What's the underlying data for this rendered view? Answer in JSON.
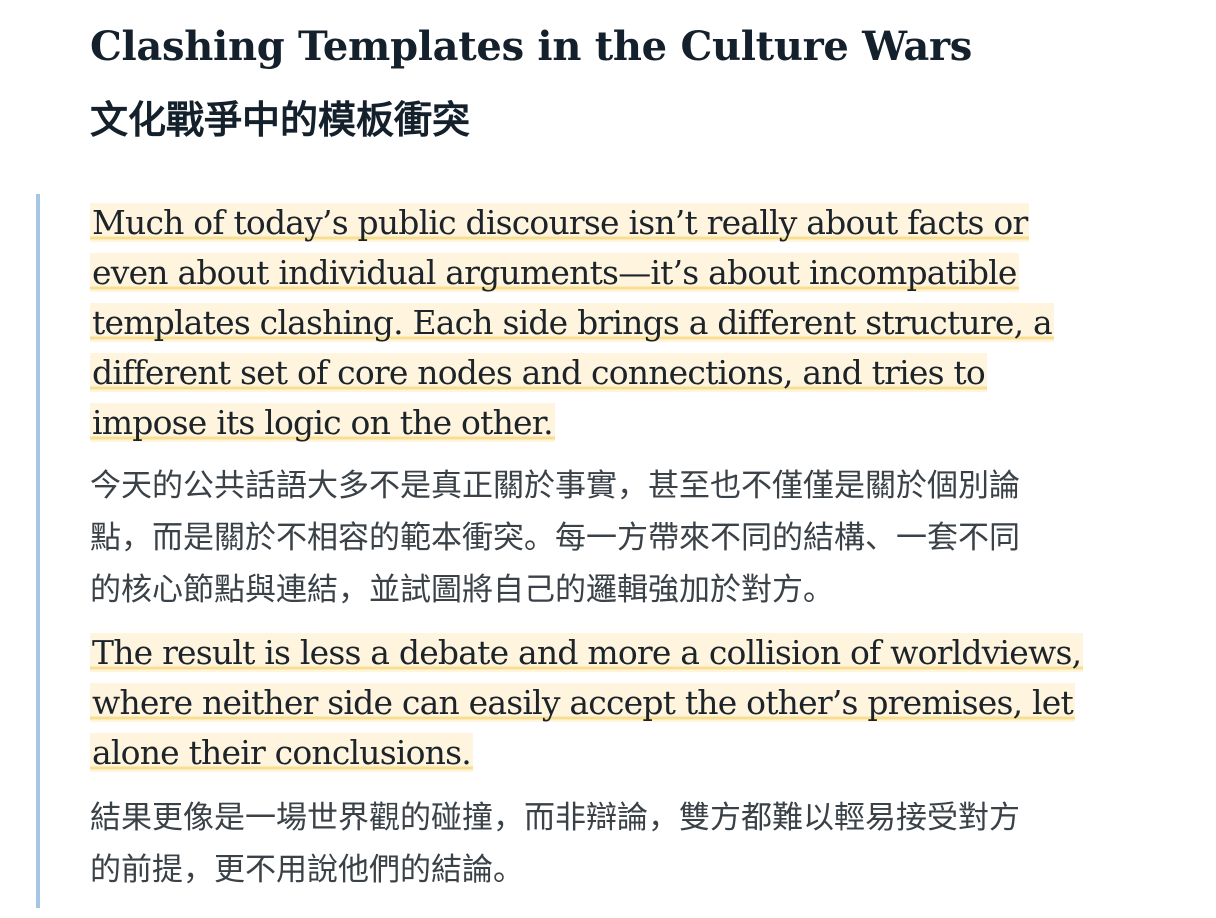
{
  "title_en": "Clashing Templates in the Culture Wars",
  "title_zh": "文化戰爭中的模板衝突",
  "quote": {
    "accent_color": "#a7c6e4",
    "highlight_color": "#fff5df",
    "underline_color": "#f8de90",
    "para1_en": [
      "Much of today’s public discourse isn’t really about facts or",
      "even about individual arguments—it’s about incompatible",
      "templates clashing. Each side brings a different structure, a",
      "different set of core nodes and connections, and tries to",
      "impose its logic on the other."
    ],
    "para1_zh": [
      "今天的公共話語大多不是真正關於事實，甚至也不僅僅是關於個別論",
      "點，而是關於不相容的範本衝突。每一方帶來不同的結構、一套不同",
      "的核心節點與連結，並試圖將自己的邏輯強加於對方。"
    ],
    "para2_en": [
      "The result is less a debate and more a collision of worldviews,",
      "where neither side can easily accept the other’s premises, let",
      "alone their conclusions."
    ],
    "para2_zh": [
      "結果更像是一場世界觀的碰撞，而非辯論，雙方都難以輕易接受對方",
      "的前提，更不用說他們的結論。"
    ]
  }
}
